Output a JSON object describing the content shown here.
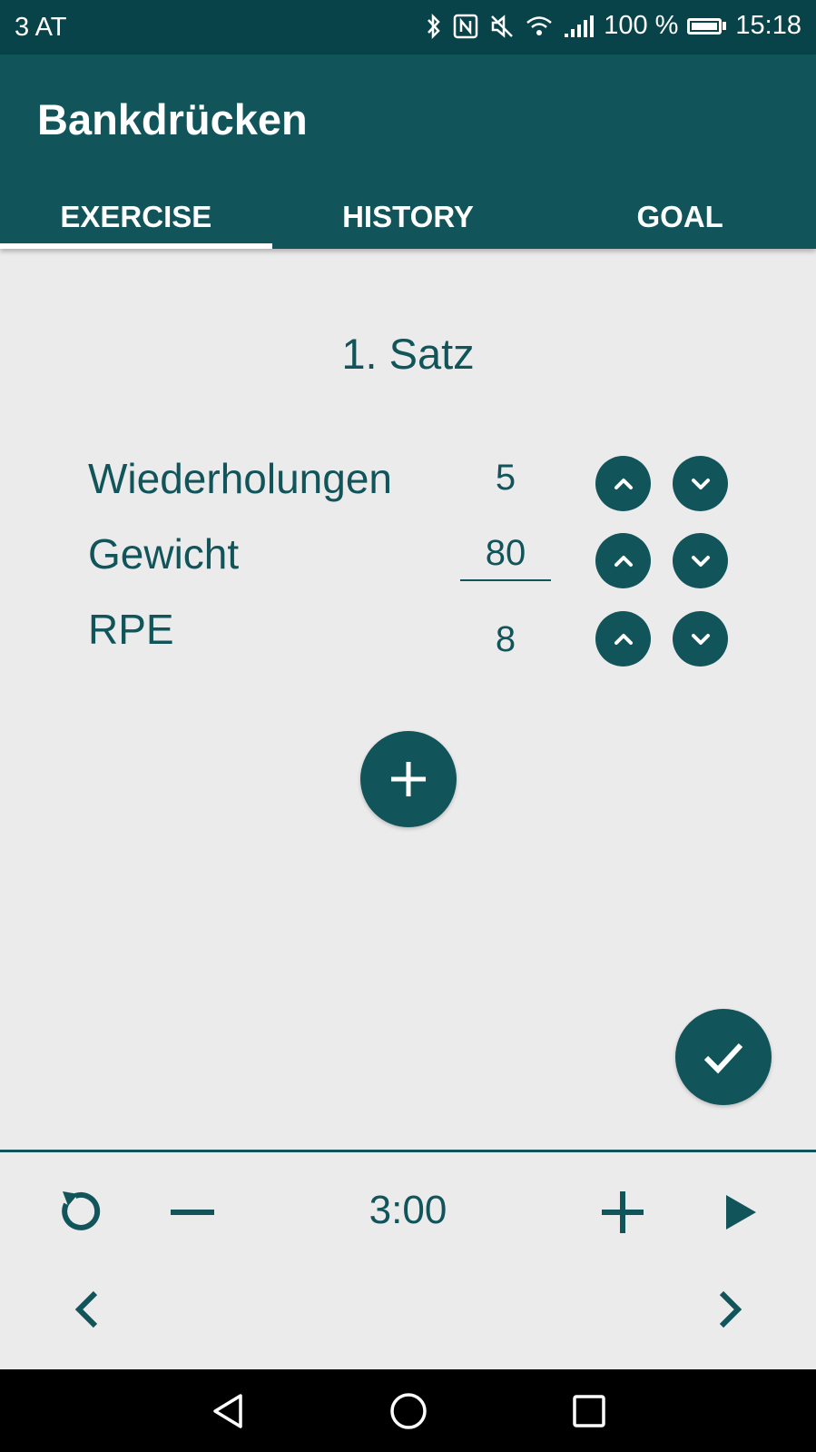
{
  "status_bar": {
    "carrier": "3 AT",
    "battery": "100 %",
    "time": "15:18"
  },
  "app_bar": {
    "title": "Bankdrücken"
  },
  "tabs": [
    {
      "label": "EXERCISE",
      "active": true
    },
    {
      "label": "HISTORY",
      "active": false
    },
    {
      "label": "GOAL",
      "active": false
    }
  ],
  "exercise": {
    "set_title": "1. Satz",
    "fields": [
      {
        "label": "Wiederholungen",
        "value": "5"
      },
      {
        "label": "Gewicht",
        "value": "80"
      },
      {
        "label": "RPE",
        "value": "8"
      }
    ]
  },
  "timer": {
    "value": "3:00"
  },
  "colors": {
    "primary": "#11555b",
    "status_bar": "#084349",
    "background": "#ecebec"
  },
  "icons": [
    "bluetooth-icon",
    "nfc-icon",
    "mute-icon",
    "wifi-icon",
    "signal-icon",
    "battery-icon",
    "chevron-up-icon",
    "chevron-down-icon",
    "plus-icon",
    "check-icon",
    "reset-icon",
    "minus-icon",
    "play-icon",
    "chevron-left-icon",
    "chevron-right-icon",
    "back-icon",
    "home-icon",
    "recents-icon"
  ]
}
